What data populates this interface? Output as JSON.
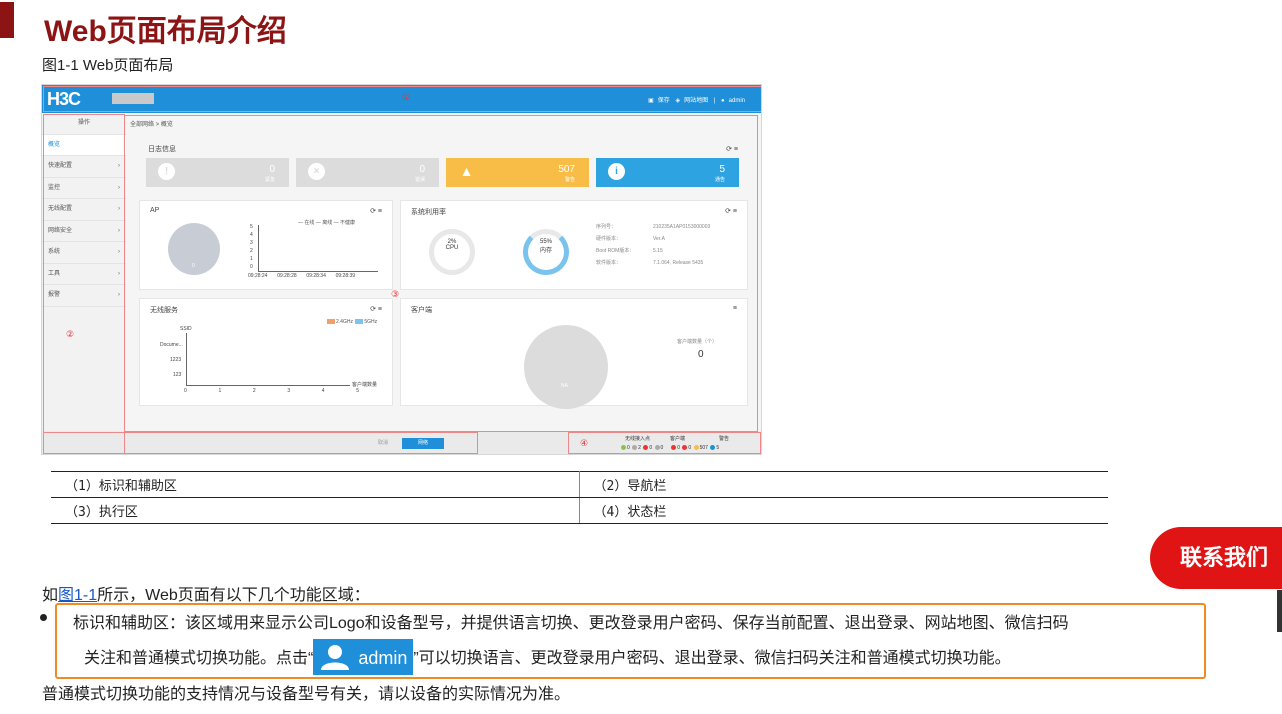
{
  "heading": "Web页面布局介绍",
  "figure_caption": "图1-1 Web页面布局",
  "figure": {
    "logo": "H3C",
    "topbar_links": [
      "保存",
      "网站地图",
      "|",
      "admin"
    ],
    "zone_markers": [
      "①",
      "②",
      "③",
      "④"
    ],
    "sidebar_items": [
      "操作",
      "概览",
      "快速配置",
      "监控",
      "无线配置",
      "网络安全",
      "系统",
      "工具",
      "报警"
    ],
    "breadcrumb": "全部网络 > 概览",
    "log_panel": {
      "title": "日志信息",
      "tiles": [
        {
          "value": "0",
          "label": "紧急",
          "icon": "!",
          "color": "#d9d9d9"
        },
        {
          "value": "0",
          "label": "错误",
          "icon": "×",
          "color": "#d9d9d9"
        },
        {
          "value": "507",
          "label": "警告",
          "icon": "!",
          "color": "#f7bd47"
        },
        {
          "value": "5",
          "label": "通告",
          "icon": "i",
          "color": "#2ea3e2"
        }
      ]
    },
    "ap_panel": {
      "title": "AP",
      "legend": [
        "在线",
        "离线",
        "不健康"
      ],
      "yticks": [
        "5",
        "4",
        "3",
        "2",
        "1",
        "0"
      ],
      "xticks": [
        "09:28:24",
        "09:28:28",
        "09:28:34",
        "09:28:39"
      ],
      "pie_value": "0"
    },
    "sys_panel": {
      "title": "系统利用率",
      "cpu_value": "2%",
      "cpu_label": "CPU",
      "mem_value": "55%",
      "mem_label": "内存",
      "info_keys": [
        "序列号：",
        "硬件版本：",
        "Boot ROM版本：",
        "软件版本："
      ],
      "info_vals": [
        "210235A1AP0153000003",
        "Ver.A",
        "5.15",
        "7.1.064, Release 5435"
      ]
    },
    "wireless_panel": {
      "title": "无线服务",
      "legend": [
        "2.4GHz",
        "5GHz"
      ],
      "ylabel": "SSID",
      "yticks": [
        "Docume...",
        "1223",
        "123"
      ],
      "xticks": [
        "0",
        "1",
        "2",
        "3",
        "4",
        "5"
      ],
      "xlabel": "客户端数量"
    },
    "client_panel": {
      "title": "客户端",
      "count_label": "客户端数量（个）",
      "count_value": "0",
      "pie_label": "NA"
    },
    "buttons": [
      "取消",
      "网络"
    ],
    "status": {
      "groups": [
        "无线接入点",
        "客户端",
        "警告"
      ],
      "values": [
        "0",
        "2",
        "0",
        "0",
        "0",
        "0",
        "507",
        "5"
      ]
    }
  },
  "legend_table": [
    [
      "（1）标识和辅助区",
      "（2）导航栏"
    ],
    [
      "（3）执行区",
      "（4）状态栏"
    ]
  ],
  "contact_button": "联系我们",
  "para1": {
    "before": "如",
    "link": "图1-1",
    "after": "所示，Web页面有以下几个功能区域："
  },
  "bullet": {
    "line1": "标识和辅助区：该区域用来显示公司Logo和设备型号，并提供语言切换、更改登录用户密码、保存当前配置、退出登录、网站地图、微信扫码",
    "line2_before": "关注和普通模式切换功能。点击“",
    "admin_text": "admin",
    "line2_after": "”可以切换语言、更改登录用户密码、退出登录、微信扫码关注和普通模式切换功能。"
  },
  "para3": "普通模式切换功能的支持情况与设备型号有关，请以设备的实际情况为准。"
}
